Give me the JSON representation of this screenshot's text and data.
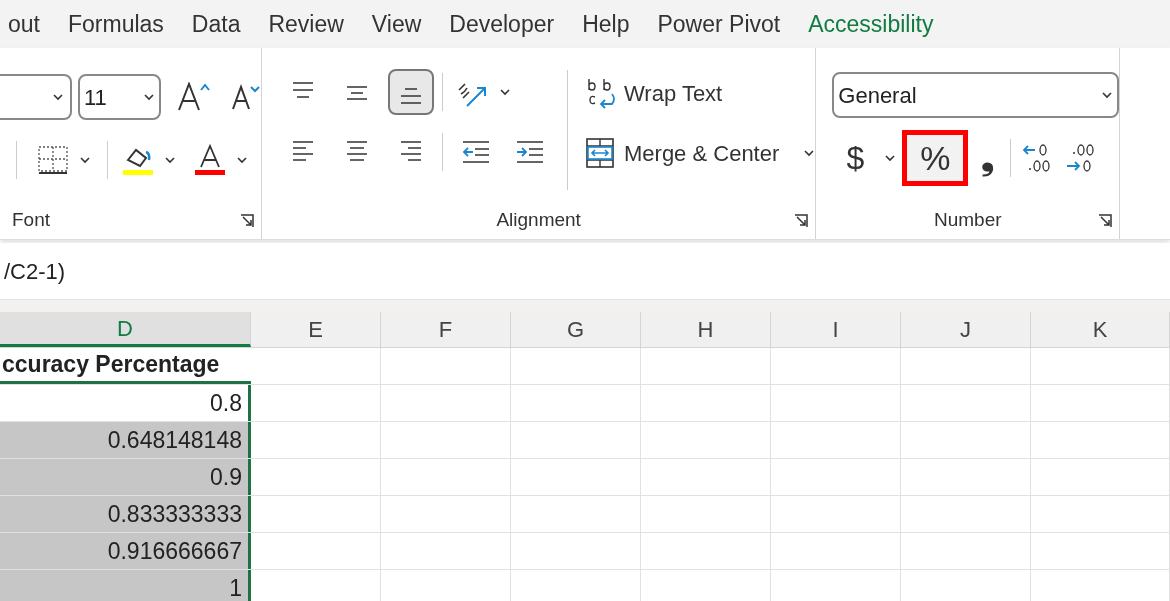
{
  "tabs": [
    {
      "label": "out",
      "selected": false,
      "contextual": false
    },
    {
      "label": "Formulas",
      "selected": false,
      "contextual": false
    },
    {
      "label": "Data",
      "selected": false,
      "contextual": false
    },
    {
      "label": "Review",
      "selected": false,
      "contextual": false
    },
    {
      "label": "View",
      "selected": false,
      "contextual": false
    },
    {
      "label": "Developer",
      "selected": false,
      "contextual": false
    },
    {
      "label": "Help",
      "selected": false,
      "contextual": false
    },
    {
      "label": "Power Pivot",
      "selected": false,
      "contextual": false
    },
    {
      "label": "Accessibility",
      "selected": false,
      "contextual": true
    }
  ],
  "font_group": {
    "font_size": "11",
    "label": "Font"
  },
  "alignment_group": {
    "top_row": [
      {
        "kind": "top",
        "pressed": false
      },
      {
        "kind": "middle",
        "pressed": false
      },
      {
        "kind": "bottom",
        "pressed": true
      }
    ],
    "bottom_row": [
      {
        "kind": "left",
        "pressed": false
      },
      {
        "kind": "center",
        "pressed": false
      },
      {
        "kind": "right",
        "pressed": false
      }
    ],
    "wrap_text": "Wrap Text",
    "merge": "Merge & Center",
    "label": "Alignment"
  },
  "number_group": {
    "format": "General",
    "currency": "$",
    "percent": "%",
    "percent_highlighted": true,
    "comma": "❟",
    "label": "Number"
  },
  "formula_bar": {
    "text": "/C2-1)"
  },
  "columns": [
    {
      "label": "D",
      "selected": true
    },
    {
      "label": "E",
      "selected": false
    },
    {
      "label": "F",
      "selected": false
    },
    {
      "label": "G",
      "selected": false
    },
    {
      "label": "H",
      "selected": false
    },
    {
      "label": "I",
      "selected": false
    },
    {
      "label": "J",
      "selected": false
    },
    {
      "label": "K",
      "selected": false
    }
  ],
  "rows": [
    {
      "value": "ccuracy Percentage",
      "header": true,
      "selected": false
    },
    {
      "value": "0.8",
      "header": false,
      "selected": false
    },
    {
      "value": "0.648148148",
      "header": false,
      "selected": true
    },
    {
      "value": "0.9",
      "header": false,
      "selected": true
    },
    {
      "value": "0.833333333",
      "header": false,
      "selected": true
    },
    {
      "value": "0.916666667",
      "header": false,
      "selected": true
    },
    {
      "value": "1",
      "header": false,
      "selected": true
    }
  ]
}
